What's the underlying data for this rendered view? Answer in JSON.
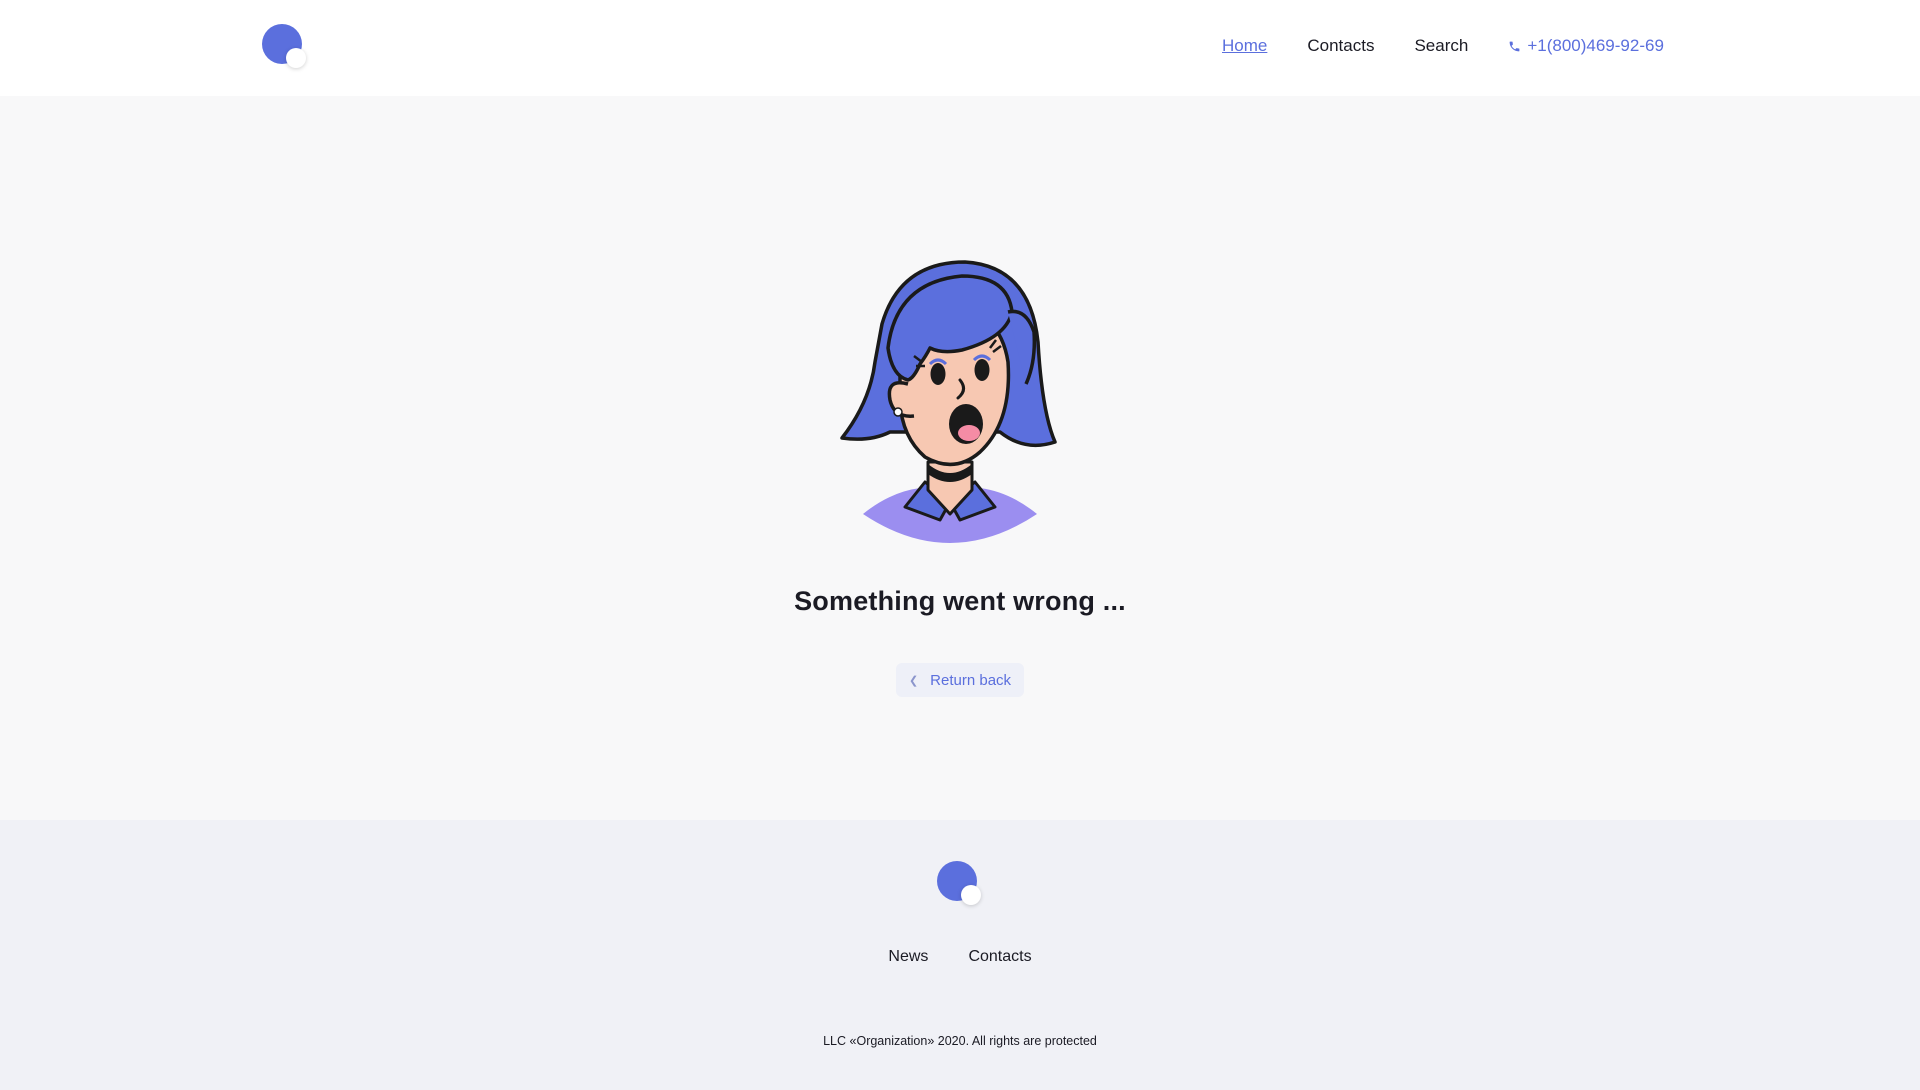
{
  "header": {
    "logo_icon": "brand-logo-icon",
    "nav": {
      "home": "Home",
      "contacts": "Contacts",
      "search": "Search",
      "phone": "+1(800)469-92-69"
    }
  },
  "main": {
    "illustration": "surprised-girl-illustration",
    "title": "Something went wrong ...",
    "return_button": "Return back"
  },
  "footer": {
    "logo_icon": "brand-logo-icon",
    "nav": {
      "news": "News",
      "contacts": "Contacts"
    },
    "copyright": "LLC «Organization» 2020. All rights are protected"
  },
  "colors": {
    "accent": "#5b6fdd",
    "page_bg": "#f8f8f9",
    "footer_bg": "#f0f1f6",
    "text": "#1b1b24"
  }
}
